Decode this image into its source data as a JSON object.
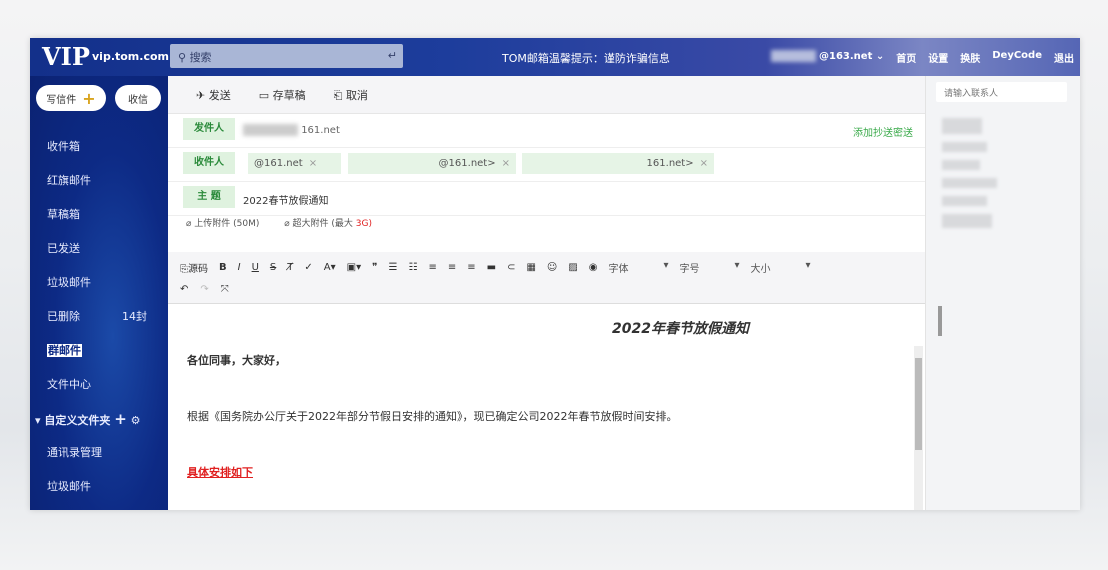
{
  "header": {
    "logo": "VIP",
    "domain": "vip.tom.com",
    "search_placeholder": "搜索",
    "notice": "TOM邮箱温馨提示：谨防诈骗信息",
    "account": "@163.net",
    "links": [
      "首页",
      "设置",
      "换肤",
      "DeyCode",
      "退出"
    ]
  },
  "sidebar": {
    "compose": "写信件",
    "receive": "收信",
    "items": [
      {
        "label": "收件箱"
      },
      {
        "label": "红旗邮件"
      },
      {
        "label": "草稿箱"
      },
      {
        "label": "已发送"
      },
      {
        "label": "垃圾邮件"
      },
      {
        "label": "已删除",
        "count": "14封"
      },
      {
        "label": "群邮件"
      },
      {
        "label": "文件中心"
      }
    ],
    "folder_header": "自定义文件夹",
    "folder_items": [
      "通讯录管理",
      "垃圾邮件"
    ]
  },
  "toolbar": {
    "send": "发送",
    "draft": "存草稿",
    "cancel": "取消"
  },
  "compose": {
    "from_label": "发件人",
    "from_value": "161.net",
    "add_cc": "添加抄送密送",
    "to_label": "收件人",
    "recipients": [
      "@161.net",
      "@161.net>",
      "161.net>"
    ],
    "subject_label": "主 题",
    "subject": "2022春节放假通知",
    "attach": "上传附件 (50M)",
    "big_attach": "超大附件 (最大",
    "big_attach_limit": "3G)"
  },
  "editor": {
    "source": "源码",
    "font": "字体",
    "size": "字号",
    "style": "大小"
  },
  "body": {
    "title": "2022年春节放假通知",
    "greeting": "各位同事，大家好，",
    "paragraph": "根据《国务院办公厅关于2022年部分节假日安排的通知》，现已确定公司2022年春节放假时间安排。",
    "link": "具体安排如下"
  },
  "right": {
    "search_placeholder": "请输入联系人"
  }
}
